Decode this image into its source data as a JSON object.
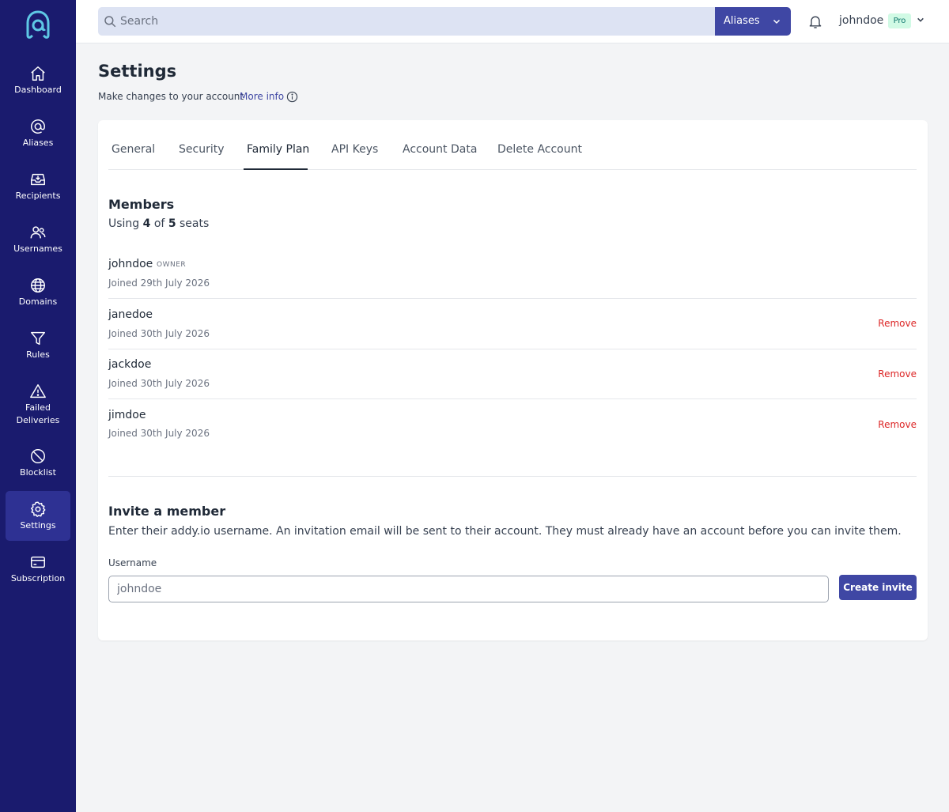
{
  "sidebar": {
    "items": [
      {
        "label": "Dashboard",
        "icon": "home-icon"
      },
      {
        "label": "Aliases",
        "icon": "at-sign-icon"
      },
      {
        "label": "Recipients",
        "icon": "inbox-icon"
      },
      {
        "label": "Usernames",
        "icon": "users-icon"
      },
      {
        "label": "Domains",
        "icon": "globe-icon"
      },
      {
        "label": "Rules",
        "icon": "filter-icon"
      },
      {
        "label": "Failed Deliveries",
        "icon": "warning-icon"
      },
      {
        "label": "Blocklist",
        "icon": "block-icon"
      },
      {
        "label": "Settings",
        "icon": "gear-icon",
        "active": true
      },
      {
        "label": "Subscription",
        "icon": "credit-card-icon"
      }
    ]
  },
  "topbar": {
    "search_placeholder": "Search",
    "scope_label": "Aliases",
    "username": "johndoe",
    "plan_badge": "Pro"
  },
  "page": {
    "title": "Settings",
    "subtitle": "Make changes to your account",
    "more_info": "More info"
  },
  "tabs": [
    {
      "label": "General"
    },
    {
      "label": "Security"
    },
    {
      "label": "Family Plan",
      "active": true
    },
    {
      "label": "API Keys"
    },
    {
      "label": "Account Data"
    },
    {
      "label": "Delete Account"
    }
  ],
  "members": {
    "title": "Members",
    "seats_prefix": "Using",
    "seats_used": "4",
    "seats_of": "of",
    "seats_total": "5",
    "seats_suffix": "seats",
    "list": [
      {
        "name": "johndoe",
        "role": "OWNER",
        "joined": "Joined 29th July 2026"
      },
      {
        "name": "janedoe",
        "joined": "Joined 30th July 2026",
        "action": "Remove"
      },
      {
        "name": "jackdoe",
        "joined": "Joined 30th July 2026",
        "action": "Remove"
      },
      {
        "name": "jimdoe",
        "joined": "Joined 30th July 2026",
        "action": "Remove"
      }
    ]
  },
  "invite": {
    "title": "Invite a member",
    "description": "Enter their addy.io username. An invitation email will be sent to their account. They must already have an account before you can invite them.",
    "field_label": "Username",
    "placeholder": "johndoe",
    "button": "Create invite"
  },
  "colors": {
    "sidebar_bg": "#1a1b6e",
    "sidebar_active": "#2e3193",
    "primary": "#3f47a4",
    "danger": "#dc2626",
    "badge_bg": "#d1fae5",
    "badge_text": "#0f766e"
  }
}
